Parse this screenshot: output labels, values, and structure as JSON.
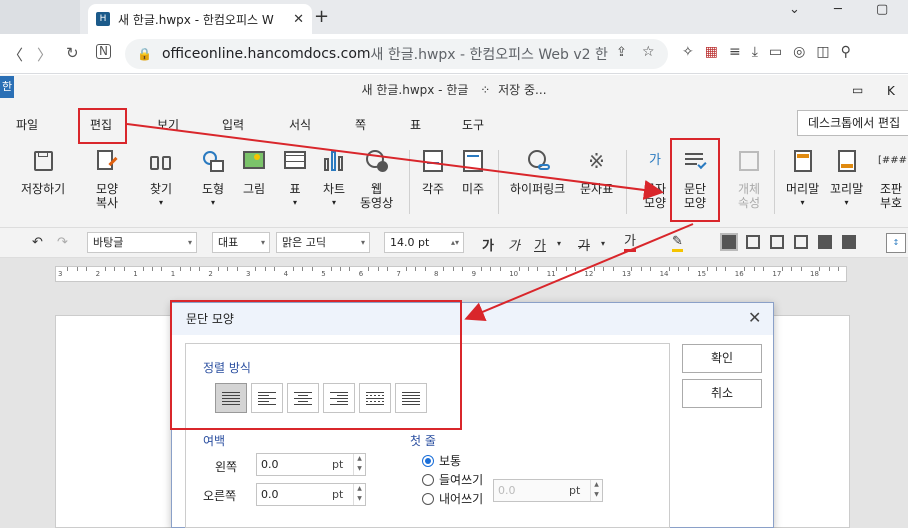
{
  "browser": {
    "tab_title": "새 한글.hwpx - 한컴오피스 W",
    "tab_favicon": "H",
    "url_host": "officeonline.hancomdocs.com",
    "url_path": " 새 한글.hwpx - 한컴오피스 Web v2 한",
    "icons": [
      "back-icon",
      "forward-icon",
      "reload-icon",
      "home-icon",
      "lock-icon",
      "share-icon",
      "bookmark-icon",
      "extensions-icon",
      "flag-icon",
      "reading-list-icon",
      "download-icon",
      "cast-icon",
      "screenshot-icon",
      "sidebar-icon",
      "profile-icon"
    ]
  },
  "app": {
    "logo": "한",
    "title": "새 한글.hwpx - 한글",
    "save_status": "저장 중...",
    "desktop_button": "데스크톱에서 편집",
    "right_k": "K"
  },
  "menus": [
    "파일",
    "편집",
    "보기",
    "입력",
    "서식",
    "쪽",
    "표",
    "도구"
  ],
  "ribbon": {
    "save": "저장하기",
    "copy_format_1": "모양",
    "copy_format_2": "복사",
    "find": "찾기",
    "shape": "도형",
    "picture": "그림",
    "table": "표",
    "chart": "차트",
    "web_video_1": "웹",
    "web_video_2": "동영상",
    "footnote": "각주",
    "endnote": "미주",
    "hyperlink": "하이퍼링크",
    "symbol": "문자표",
    "char_shape_1": "글자",
    "char_shape_2": "모양",
    "para_shape_1": "문단",
    "para_shape_2": "모양",
    "object_prop_1": "개체",
    "object_prop_2": "속성",
    "header": "머리말",
    "footer": "꼬리말",
    "assembly_1": "조판",
    "assembly_2": "부호",
    "assembly_icon": "[###]",
    "char_icon": "가"
  },
  "format_bar": {
    "style": "바탕글",
    "lang": "대표",
    "font": "맑은 고딕",
    "size": "14.0",
    "size_unit": "pt",
    "bold": "가",
    "italic": "가",
    "underline": "가",
    "strike": "가",
    "color": "가"
  },
  "ruler": [
    "3",
    "2",
    "1",
    "1",
    "2",
    "3",
    "4",
    "5",
    "6",
    "7",
    "8",
    "9",
    "10",
    "11",
    "12",
    "13",
    "14",
    "15",
    "16",
    "17",
    "18"
  ],
  "dialog": {
    "title": "문단 모양",
    "ok": "확인",
    "cancel": "취소",
    "align_header": "정렬 방식",
    "margin_header": "여백",
    "left_label": "왼쪽",
    "right_label": "오른쪽",
    "left_value": "0.0",
    "right_value": "0.0",
    "unit": "pt",
    "first_line_header": "첫 줄",
    "normal": "보통",
    "indent": "들여쓰기",
    "outdent": "내어쓰기",
    "first_value": "0.0"
  }
}
